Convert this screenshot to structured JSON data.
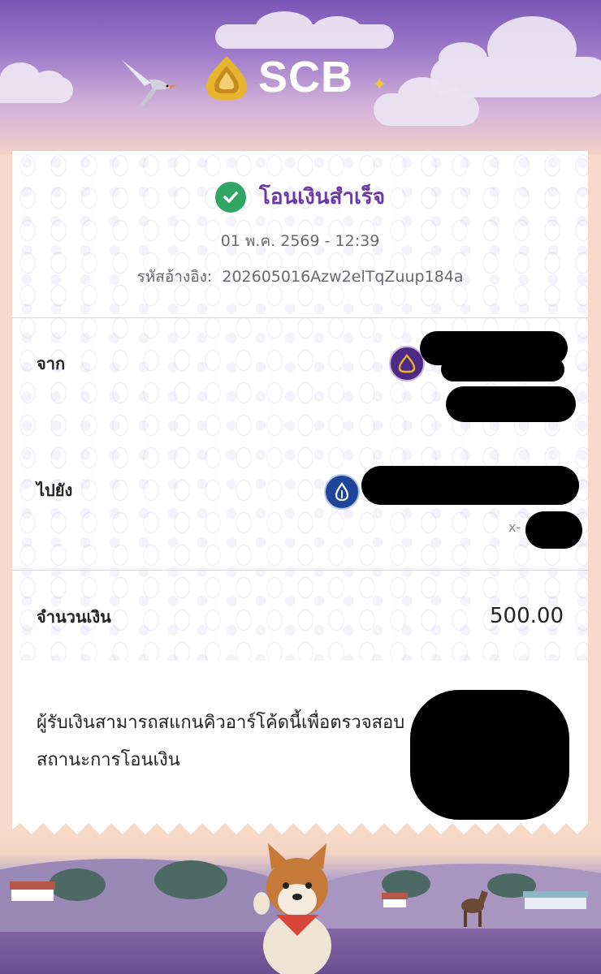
{
  "header": {
    "brand": "SCB",
    "bird_icon": "bird-icon",
    "logo_icon": "scb-logo-icon"
  },
  "receipt": {
    "status": "โอนเงินสำเร็จ",
    "status_icon": "check-circle-icon",
    "datetime": "01 พ.ค. 2569 - 12:39",
    "reference_label": "รหัสอ้างอิง:",
    "reference_value": "202605016Azw2elTqZuup184a",
    "from_label": "จาก",
    "from_bank_icon": "scb-bank-icon",
    "to_label": "ไปยัง",
    "to_bank_icon": "bbl-bank-icon",
    "to_account_prefix": "x-",
    "amount_label": "จำนวนเงิน",
    "amount_value": "500.00",
    "note": "ผู้รับเงินสามารถสแกนคิวอาร์โค้ดนี้เพื่อตรวจสอบสถานะการโอนเงิน"
  },
  "colors": {
    "brand_purple": "#6a3aa8",
    "success_green": "#2fa662",
    "scb_icon_bg": "#4e2a84",
    "bbl_icon_bg": "#1e4598"
  }
}
